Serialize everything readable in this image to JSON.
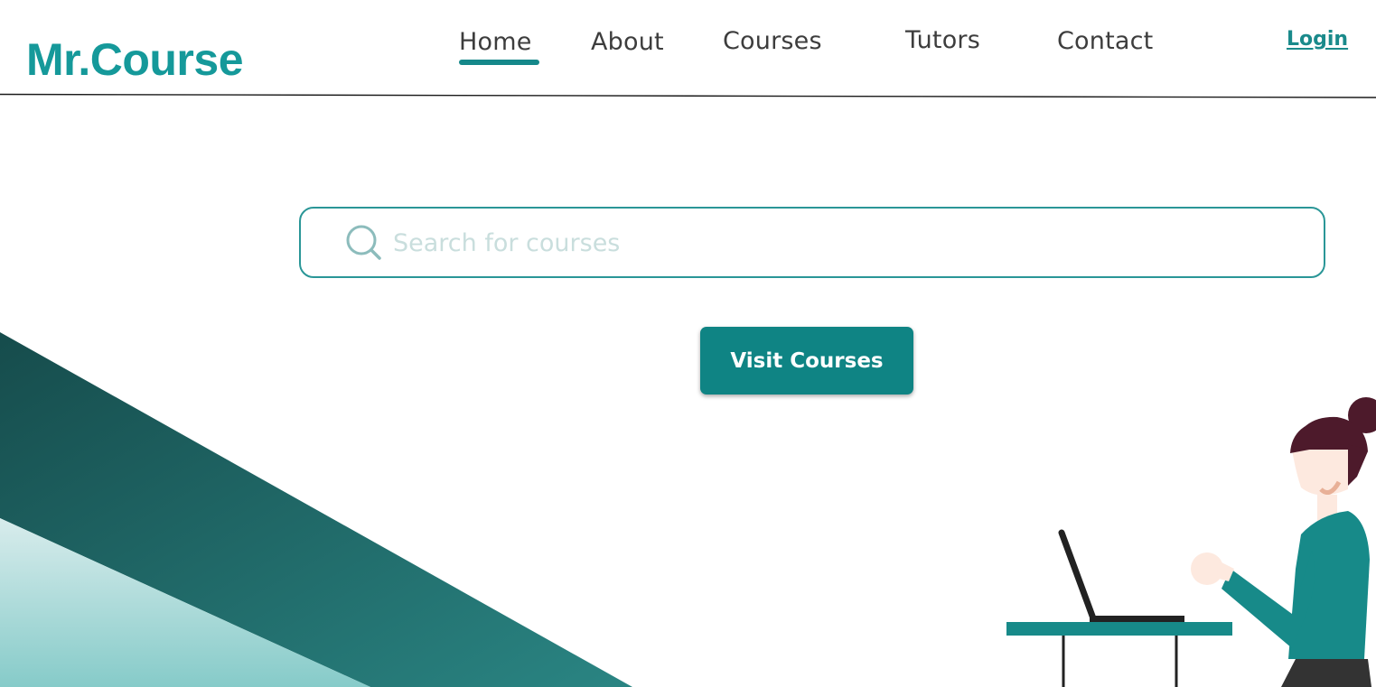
{
  "brand": {
    "name": "Mr.Course",
    "color": "#15999a"
  },
  "nav": {
    "items": [
      {
        "label": "Home",
        "active": true
      },
      {
        "label": "About",
        "active": false
      },
      {
        "label": "Courses",
        "active": false
      },
      {
        "label": "Tutors",
        "active": false
      },
      {
        "label": "Contact",
        "active": false
      }
    ],
    "login_label": "Login"
  },
  "search": {
    "placeholder": "Search for courses",
    "value": "",
    "icon": "search-icon"
  },
  "hero": {
    "cta_label": "Visit Courses"
  },
  "colors": {
    "accent": "#15999a",
    "button": "#0f8484",
    "dark_teal": "#154e4e",
    "light_teal": "#8fcfcd"
  }
}
